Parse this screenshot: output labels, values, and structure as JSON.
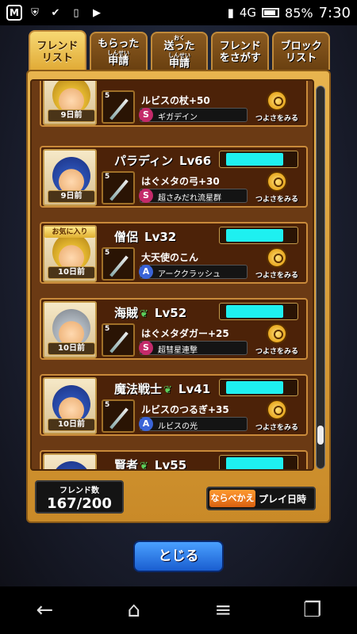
{
  "statusbar": {
    "network": "4G",
    "battery": "85%",
    "time": "7:30"
  },
  "tabs": [
    {
      "label": "フレンド\nリスト",
      "active": true
    },
    {
      "label": "もらった",
      "label2": "申請",
      "ruby": "しんせい"
    },
    {
      "label": "送った",
      "label2": "申請",
      "ruby": "おく / しんせい"
    },
    {
      "label": "フレンド",
      "label2": "をさがす"
    },
    {
      "label": "ブロック",
      "label2": "リスト"
    }
  ],
  "rows": [
    {
      "name": "",
      "level": "",
      "days": "9日前",
      "weapon": "ルビスの杖+50",
      "skill_type": "S",
      "skill": "ギガデイン",
      "stars": "5",
      "check": "つよさをみる"
    },
    {
      "name": "パラディン",
      "level": "Lv66",
      "days": "9日前",
      "weapon": "はぐメタの弓+30",
      "skill_type": "S",
      "skill": "超さみだれ流星群",
      "stars": "5",
      "check": "つよさをみる"
    },
    {
      "name": "僧侶",
      "level": "Lv32",
      "days": "10日前",
      "fav": "お気に入り",
      "weapon": "大天使のこん",
      "skill_type": "A",
      "skill": "アーククラッシュ",
      "stars": "5",
      "check": "つよさをみる"
    },
    {
      "name": "海賊",
      "level": "Lv52",
      "days": "10日前",
      "weapon": "はぐメタダガー+25",
      "skill_type": "S",
      "skill": "超彗星連撃",
      "stars": "5",
      "check": "つよさをみる"
    },
    {
      "name": "魔法戦士",
      "level": "Lv41",
      "days": "10日前",
      "weapon": "ルビスのつるぎ+35",
      "skill_type": "A",
      "skill": "ルビスの光",
      "stars": "5",
      "check": "つよさをみる"
    },
    {
      "name": "賢者",
      "level": "Lv55",
      "days": "",
      "weapon": "",
      "skill_type": "",
      "skill": "",
      "stars": "",
      "check": ""
    }
  ],
  "friend_count": {
    "label": "フレンド数",
    "value": "167/200"
  },
  "sort": {
    "button": "ならべかえ",
    "value": "プレイ日時"
  },
  "close_label": "とじる",
  "navbar": {
    "back": "←",
    "home": "⌂",
    "menu": "≡",
    "recent": "❐"
  }
}
